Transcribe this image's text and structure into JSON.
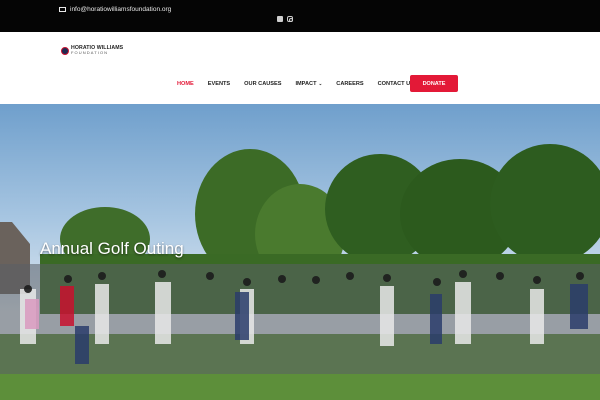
{
  "topbar": {
    "email": "info@horatiowilliamsfoundation.org",
    "social": [
      "facebook-icon",
      "instagram-icon"
    ]
  },
  "logo": {
    "name": "HORATIO WILLIAMS",
    "sub": "FOUNDATION"
  },
  "nav": {
    "items": [
      {
        "label": "HOME",
        "active": true
      },
      {
        "label": "EVENTS"
      },
      {
        "label": "OUR CAUSES"
      },
      {
        "label": "IMPACT"
      },
      {
        "label": "CAREERS"
      },
      {
        "label": "CONTACT US"
      }
    ],
    "donate_label": "DONATE"
  },
  "hero": {
    "title": "Annual Golf Outing"
  },
  "colors": {
    "accent": "#e31937",
    "topbar": "#050505"
  }
}
